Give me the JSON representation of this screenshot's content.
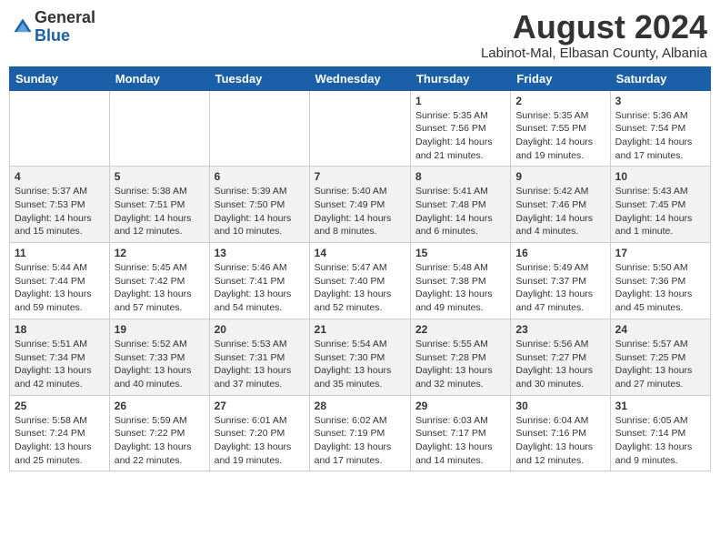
{
  "header": {
    "logo_general": "General",
    "logo_blue": "Blue",
    "month_year": "August 2024",
    "location": "Labinot-Mal, Elbasan County, Albania"
  },
  "weekdays": [
    "Sunday",
    "Monday",
    "Tuesday",
    "Wednesday",
    "Thursday",
    "Friday",
    "Saturday"
  ],
  "weeks": [
    [
      {
        "day": "",
        "info": ""
      },
      {
        "day": "",
        "info": ""
      },
      {
        "day": "",
        "info": ""
      },
      {
        "day": "",
        "info": ""
      },
      {
        "day": "1",
        "info": "Sunrise: 5:35 AM\nSunset: 7:56 PM\nDaylight: 14 hours\nand 21 minutes."
      },
      {
        "day": "2",
        "info": "Sunrise: 5:35 AM\nSunset: 7:55 PM\nDaylight: 14 hours\nand 19 minutes."
      },
      {
        "day": "3",
        "info": "Sunrise: 5:36 AM\nSunset: 7:54 PM\nDaylight: 14 hours\nand 17 minutes."
      }
    ],
    [
      {
        "day": "4",
        "info": "Sunrise: 5:37 AM\nSunset: 7:53 PM\nDaylight: 14 hours\nand 15 minutes."
      },
      {
        "day": "5",
        "info": "Sunrise: 5:38 AM\nSunset: 7:51 PM\nDaylight: 14 hours\nand 12 minutes."
      },
      {
        "day": "6",
        "info": "Sunrise: 5:39 AM\nSunset: 7:50 PM\nDaylight: 14 hours\nand 10 minutes."
      },
      {
        "day": "7",
        "info": "Sunrise: 5:40 AM\nSunset: 7:49 PM\nDaylight: 14 hours\nand 8 minutes."
      },
      {
        "day": "8",
        "info": "Sunrise: 5:41 AM\nSunset: 7:48 PM\nDaylight: 14 hours\nand 6 minutes."
      },
      {
        "day": "9",
        "info": "Sunrise: 5:42 AM\nSunset: 7:46 PM\nDaylight: 14 hours\nand 4 minutes."
      },
      {
        "day": "10",
        "info": "Sunrise: 5:43 AM\nSunset: 7:45 PM\nDaylight: 14 hours\nand 1 minute."
      }
    ],
    [
      {
        "day": "11",
        "info": "Sunrise: 5:44 AM\nSunset: 7:44 PM\nDaylight: 13 hours\nand 59 minutes."
      },
      {
        "day": "12",
        "info": "Sunrise: 5:45 AM\nSunset: 7:42 PM\nDaylight: 13 hours\nand 57 minutes."
      },
      {
        "day": "13",
        "info": "Sunrise: 5:46 AM\nSunset: 7:41 PM\nDaylight: 13 hours\nand 54 minutes."
      },
      {
        "day": "14",
        "info": "Sunrise: 5:47 AM\nSunset: 7:40 PM\nDaylight: 13 hours\nand 52 minutes."
      },
      {
        "day": "15",
        "info": "Sunrise: 5:48 AM\nSunset: 7:38 PM\nDaylight: 13 hours\nand 49 minutes."
      },
      {
        "day": "16",
        "info": "Sunrise: 5:49 AM\nSunset: 7:37 PM\nDaylight: 13 hours\nand 47 minutes."
      },
      {
        "day": "17",
        "info": "Sunrise: 5:50 AM\nSunset: 7:36 PM\nDaylight: 13 hours\nand 45 minutes."
      }
    ],
    [
      {
        "day": "18",
        "info": "Sunrise: 5:51 AM\nSunset: 7:34 PM\nDaylight: 13 hours\nand 42 minutes."
      },
      {
        "day": "19",
        "info": "Sunrise: 5:52 AM\nSunset: 7:33 PM\nDaylight: 13 hours\nand 40 minutes."
      },
      {
        "day": "20",
        "info": "Sunrise: 5:53 AM\nSunset: 7:31 PM\nDaylight: 13 hours\nand 37 minutes."
      },
      {
        "day": "21",
        "info": "Sunrise: 5:54 AM\nSunset: 7:30 PM\nDaylight: 13 hours\nand 35 minutes."
      },
      {
        "day": "22",
        "info": "Sunrise: 5:55 AM\nSunset: 7:28 PM\nDaylight: 13 hours\nand 32 minutes."
      },
      {
        "day": "23",
        "info": "Sunrise: 5:56 AM\nSunset: 7:27 PM\nDaylight: 13 hours\nand 30 minutes."
      },
      {
        "day": "24",
        "info": "Sunrise: 5:57 AM\nSunset: 7:25 PM\nDaylight: 13 hours\nand 27 minutes."
      }
    ],
    [
      {
        "day": "25",
        "info": "Sunrise: 5:58 AM\nSunset: 7:24 PM\nDaylight: 13 hours\nand 25 minutes."
      },
      {
        "day": "26",
        "info": "Sunrise: 5:59 AM\nSunset: 7:22 PM\nDaylight: 13 hours\nand 22 minutes."
      },
      {
        "day": "27",
        "info": "Sunrise: 6:01 AM\nSunset: 7:20 PM\nDaylight: 13 hours\nand 19 minutes."
      },
      {
        "day": "28",
        "info": "Sunrise: 6:02 AM\nSunset: 7:19 PM\nDaylight: 13 hours\nand 17 minutes."
      },
      {
        "day": "29",
        "info": "Sunrise: 6:03 AM\nSunset: 7:17 PM\nDaylight: 13 hours\nand 14 minutes."
      },
      {
        "day": "30",
        "info": "Sunrise: 6:04 AM\nSunset: 7:16 PM\nDaylight: 13 hours\nand 12 minutes."
      },
      {
        "day": "31",
        "info": "Sunrise: 6:05 AM\nSunset: 7:14 PM\nDaylight: 13 hours\nand 9 minutes."
      }
    ]
  ]
}
